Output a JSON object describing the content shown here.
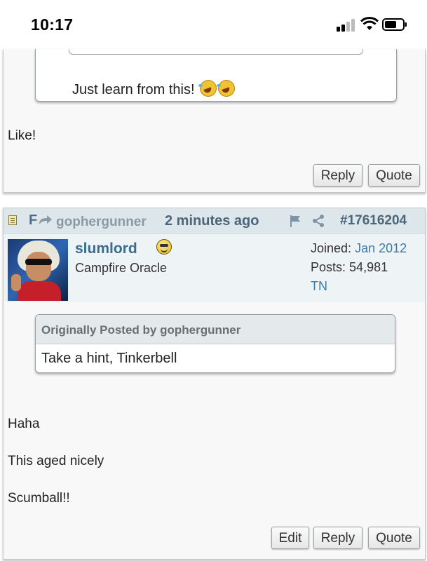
{
  "status_bar": {
    "time": "10:17",
    "icons": [
      "cellular-signal-icon",
      "wifi-icon",
      "battery-icon"
    ]
  },
  "post1": {
    "quote_text": "Just learn from this!",
    "quote_emojis": [
      "rolling-on-floor-laughing-icon",
      "rolling-on-floor-laughing-icon"
    ],
    "body": "Like!",
    "buttons": {
      "reply": "Reply",
      "quote": "Quote"
    }
  },
  "post2": {
    "header": {
      "truncated_title": "F",
      "reply_to_user": "gophergunner",
      "time_ago": "2 minutes ago",
      "post_number": "#17616204",
      "icons": [
        "document-icon",
        "reply-arrow-icon",
        "flag-icon",
        "share-icon"
      ]
    },
    "user": {
      "name": "slumlord",
      "title": "Campfire Oracle",
      "joined_label": "Joined:",
      "joined_value": "Jan 2012",
      "posts_label": "Posts:",
      "posts_value": "54,981",
      "location": "TN"
    },
    "quote": {
      "header": "Originally Posted by gophergunner",
      "text": "Take a hint, Tinkerbell"
    },
    "body_lines": [
      "Haha",
      "This aged nicely",
      "Scumball!!"
    ],
    "buttons": {
      "edit": "Edit",
      "reply": "Reply",
      "quote": "Quote"
    }
  },
  "colors": {
    "header_bg": "#dde6ea",
    "link_blue": "#3a6c8c",
    "post_bg": "#f8f8f8"
  }
}
